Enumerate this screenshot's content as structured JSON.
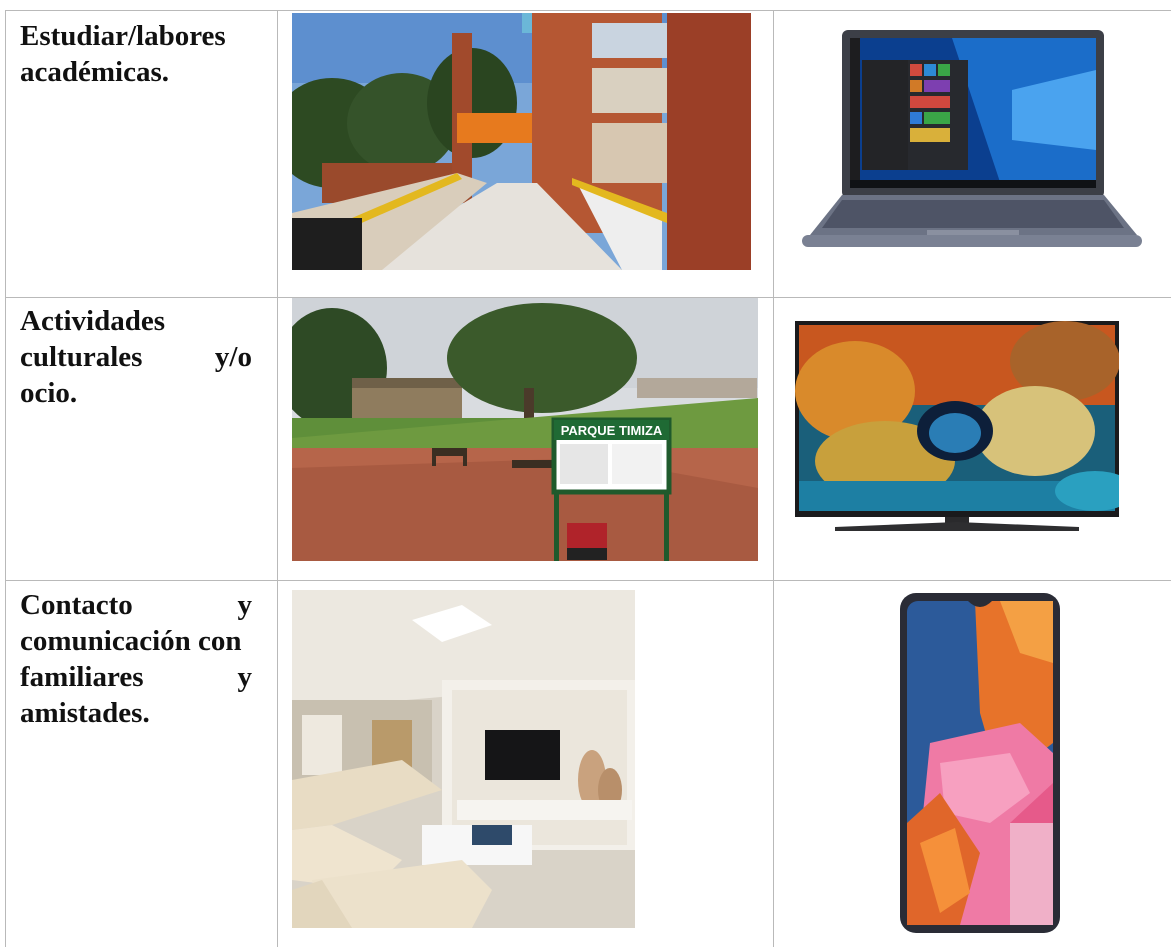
{
  "rows": [
    {
      "label_lines": [
        "Estudiar/labores",
        "académicas."
      ]
    },
    {
      "label_lines": [
        "Actividades",
        "culturales y/o",
        "ocio."
      ]
    },
    {
      "label_lines": [
        "Contacto y",
        "comunicación con",
        "familiares y",
        "amistades."
      ]
    }
  ],
  "signs": {
    "park_name": "PARQUE TIMIZA"
  },
  "colors": {
    "grid": "#b9b9b9",
    "text": "#111111"
  }
}
